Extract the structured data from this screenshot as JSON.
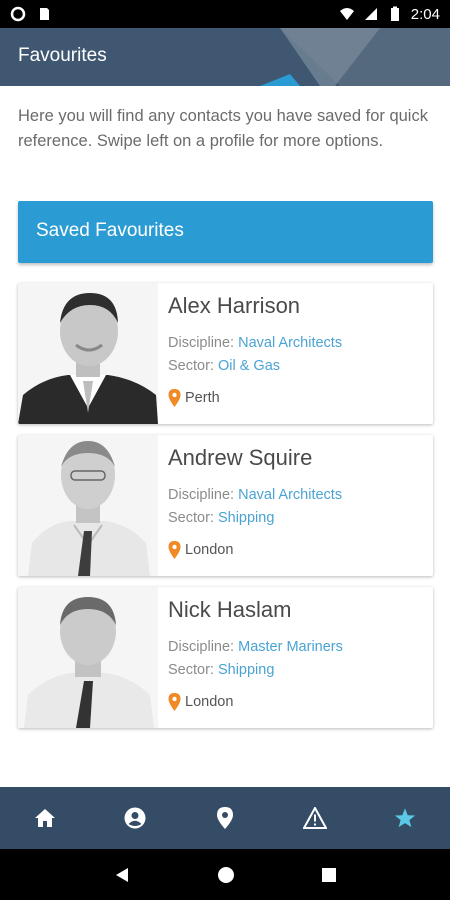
{
  "status_bar": {
    "time": "2:04",
    "icons": [
      "signal-circle-icon",
      "sd-card-icon",
      "wifi-icon",
      "cell-signal-icon",
      "battery-icon"
    ]
  },
  "header": {
    "title": "Favourites"
  },
  "intro": {
    "text": "Here you will find any contacts you have saved for quick reference. Swipe left on a profile for more options."
  },
  "section": {
    "title": "Saved Favourites"
  },
  "contacts": [
    {
      "name": "Alex Harrison",
      "discipline_label": "Discipline:",
      "discipline": "Naval Architects",
      "sector_label": "Sector:",
      "sector": "Oil & Gas",
      "location": "Perth"
    },
    {
      "name": "Andrew Squire",
      "discipline_label": "Discipline:",
      "discipline": "Naval Architects",
      "sector_label": "Sector:",
      "sector": "Shipping",
      "location": "London"
    },
    {
      "name": "Nick Haslam",
      "discipline_label": "Discipline:",
      "discipline": "Master Mariners",
      "sector_label": "Sector:",
      "sector": "Shipping",
      "location": "London"
    }
  ],
  "bottom_nav": {
    "items": [
      "home-icon",
      "profile-icon",
      "location-icon",
      "warning-icon",
      "star-icon"
    ],
    "active": "star-icon"
  },
  "colors": {
    "header": "#3f5771",
    "section": "#2b9bd3",
    "link": "#4aa3d4",
    "pin": "#f08a24",
    "nav_bg": "#344c66",
    "nav_active": "#5cc8e6"
  }
}
